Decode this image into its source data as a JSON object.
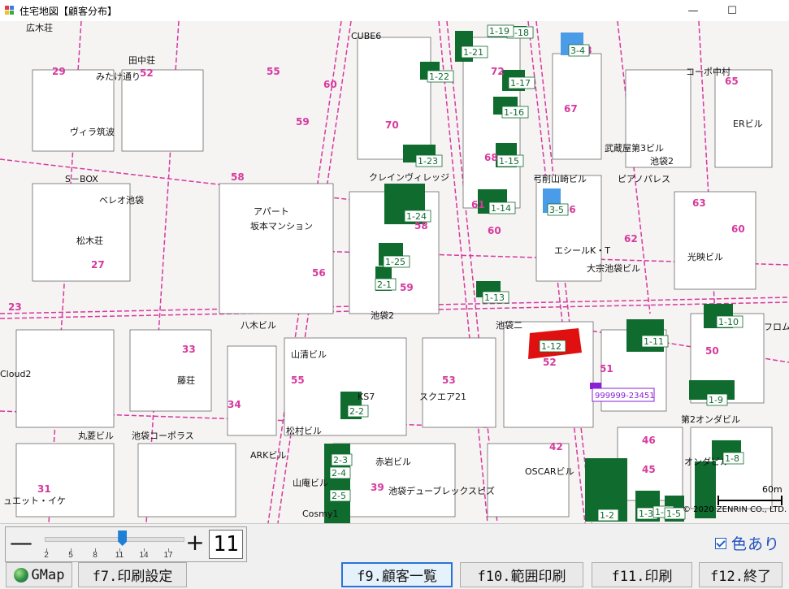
{
  "window": {
    "title": "住宅地図【顧客分布】",
    "minimize": "—",
    "maximize": "☐"
  },
  "map": {
    "places": [
      "広木荘",
      "田中荘",
      "みたけ通り",
      "ヴィラ筑波",
      "S－BOX",
      "ベレオ池袋",
      "松木荘",
      "アパート",
      "坂本マンション",
      "クレインヴィレッジ",
      "CUBE6",
      "コーポ中村",
      "ERビル",
      "武蔵屋第3ビル",
      "ピアノパレス",
      "弓削山崎ビル",
      "エシールK・T",
      "大宗池袋ビル",
      "光映ビル",
      "八木ビル",
      "山清ビル",
      "スクエア21",
      "藤荘",
      "Cloud2",
      "丸菱ビル",
      "池袋コーポラス",
      "ARKビル",
      "松村ビル",
      "赤岩ビル",
      "山庵ビル",
      "OSCARビル",
      "池袋デューブレックスビズ",
      "第2オンダビル",
      "オンダビル",
      "フロム",
      "Cosmy1",
      "ュエット・イケ",
      "KS7",
      "池袋二",
      "池袋2",
      "池袋2"
    ],
    "blocks": [
      "29",
      "52",
      "55",
      "60",
      "59",
      "70",
      "72",
      "73",
      "67",
      "65",
      "68",
      "58",
      "58",
      "60",
      "63",
      "62",
      "60",
      "56",
      "59",
      "66",
      "50",
      "33",
      "55",
      "53",
      "52",
      "51",
      "34",
      "42",
      "39",
      "46",
      "45",
      "31",
      "27",
      "61",
      "23"
    ],
    "customers": [
      "1-2",
      "1-3",
      "1-4",
      "1-5",
      "1-8",
      "1-9",
      "1-10",
      "1-11",
      "1-12",
      "1-13",
      "1-14",
      "1-15",
      "1-16",
      "1-17",
      "1-18",
      "1-19",
      "1-21",
      "1-22",
      "1-23",
      "1-24",
      "1-25",
      "2-1",
      "2-2",
      "2-3",
      "2-4",
      "2-5",
      "3-4",
      "3-5"
    ],
    "selected_customer": "999999-23451",
    "copyright": "© 2020 ZENRIN CO., LTD.",
    "scale": "60m"
  },
  "zoom": {
    "minus": "—",
    "plus": "+",
    "ticks": [
      "2",
      "5",
      "8",
      "11",
      "14",
      "17"
    ],
    "value": "11",
    "level_fraction": 0.56
  },
  "color_toggle": {
    "label": "色あり",
    "checked": true
  },
  "buttons": {
    "gmap": "GMap",
    "print_settings": "f7.印刷設定",
    "customer_list": "f9.顧客一覧",
    "range_print": "f10.範囲印刷",
    "print": "f11.印刷",
    "exit": "f12.終了"
  },
  "colors": {
    "road": "#d63a9e",
    "customer_green": "#0f6b2e",
    "selected_red": "#e01010",
    "highlight_blue": "#4a9be8",
    "block_number": "#d63a9e"
  }
}
